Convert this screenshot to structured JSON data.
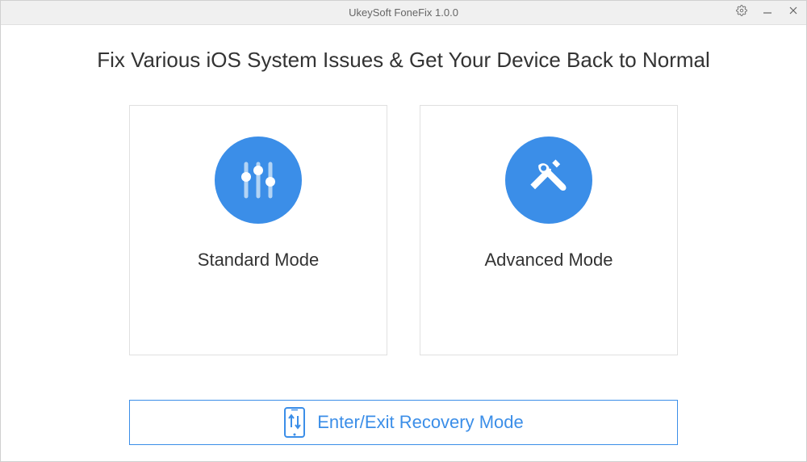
{
  "titlebar": {
    "title": "UkeySoft FoneFix 1.0.0"
  },
  "main": {
    "heading": "Fix Various iOS System Issues & Get Your Device Back to Normal",
    "modes": {
      "standard": {
        "label": "Standard Mode",
        "icon": "sliders-icon"
      },
      "advanced": {
        "label": "Advanced Mode",
        "icon": "tools-icon"
      }
    },
    "recovery": {
      "label": "Enter/Exit Recovery Mode",
      "icon": "phone-arrows-icon"
    }
  },
  "colors": {
    "accent": "#3b8ee8",
    "text_primary": "#333333",
    "text_muted": "#666666",
    "border": "#e0e0e0"
  }
}
